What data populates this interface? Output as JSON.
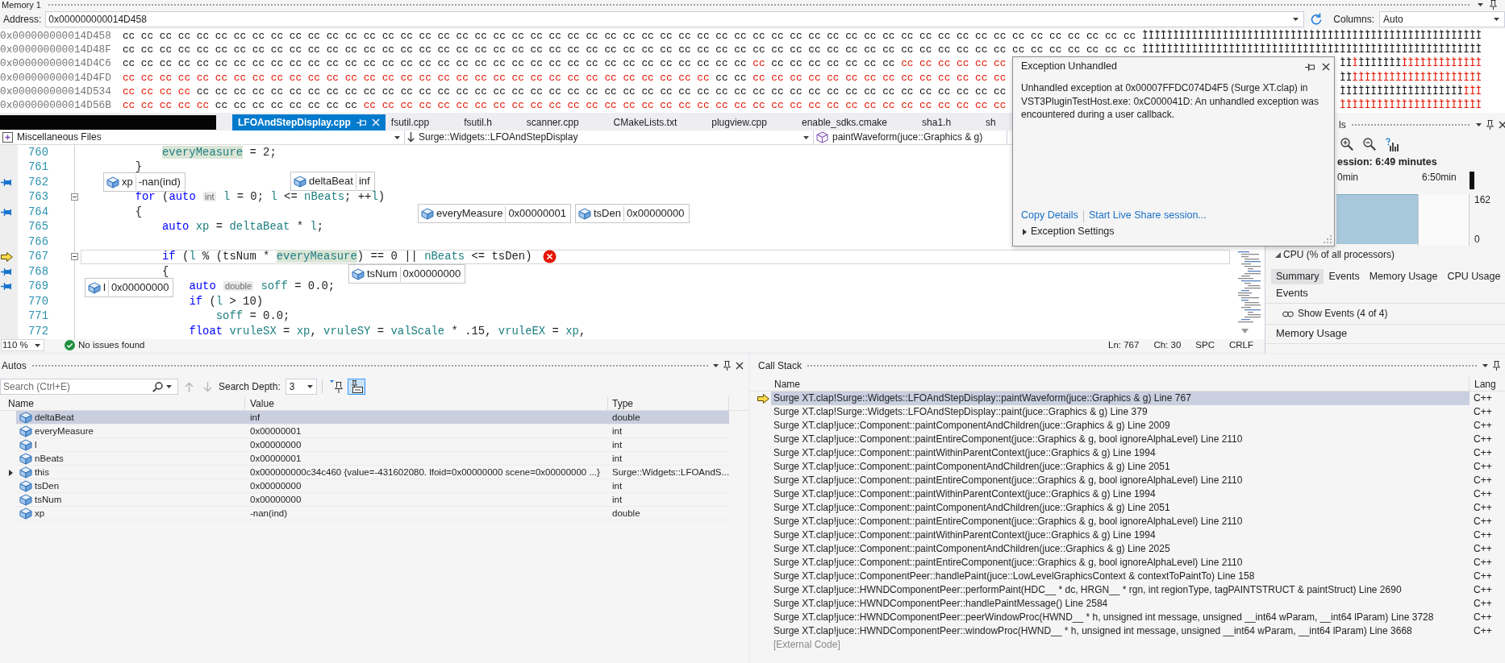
{
  "memory_window": {
    "title": "Memory 1",
    "address_label": "Address:",
    "address": "0x000000000014D458",
    "columns_label": "Columns:",
    "columns": "Auto",
    "rows": [
      {
        "address": "0x000000000014D458",
        "bytes": [
          {
            "text": "cc cc cc cc cc cc cc cc cc cc cc cc cc cc cc cc cc cc cc cc cc cc cc cc cc cc cc cc cc cc cc cc cc cc cc cc cc cc cc cc cc cc cc cc cc cc cc cc cc cc cc cc cc cc cc",
            "changed": false
          }
        ],
        "text": [
          {
            "text": "ÌÌÌÌÌÌÌÌÌÌÌÌÌÌÌÌÌÌÌÌÌÌÌÌÌÌÌÌÌÌÌÌÌÌÌÌÌÌÌÌÌÌÌÌÌÌÌÌÌÌÌÌÌÌÌ",
            "changed": false
          }
        ]
      },
      {
        "address": "0x000000000014D48F",
        "bytes": [
          {
            "text": "cc cc cc cc cc cc cc cc cc cc cc cc cc cc cc cc cc cc cc cc cc cc cc cc cc cc cc cc cc cc cc cc cc cc cc cc cc cc cc cc cc cc cc cc cc cc cc cc cc cc cc cc cc cc cc",
            "changed": false
          }
        ],
        "text": [
          {
            "text": "ÌÌÌÌÌÌÌÌÌÌÌÌÌÌÌÌÌÌÌÌÌÌÌÌÌÌÌÌÌÌÌÌÌÌÌÌÌÌÌÌÌÌÌÌÌÌÌÌÌÌÌÌÌÌÌ",
            "changed": false
          }
        ]
      },
      {
        "address": "0x000000000014D4C6",
        "bytes": [
          {
            "text": "cc cc cc cc cc cc cc cc cc cc cc cc cc cc cc cc cc cc cc cc cc cc cc cc cc cc cc cc cc cc cc cc cc cc",
            "changed": false
          },
          {
            "text": "cc",
            "changed": true
          },
          {
            "text": "cc cc cc cc cc cc cc",
            "changed": false
          },
          {
            "text": "cc cc cc cc cc cc",
            "changed": true
          }
        ],
        "text": [
          {
            "text": "ÌÌ",
            "changed": false
          },
          {
            "text": "Ì",
            "changed": true
          },
          {
            "text": "ÌÌÌÌÌÌÌ",
            "changed": false
          },
          {
            "text": "ÌÌÌÌÌÌÌÌÌÌÌÌÌ",
            "changed": true
          }
        ]
      },
      {
        "address": "0x000000000014D4FD",
        "bytes": [
          {
            "text": "cc cc cc cc cc cc cc cc cc cc cc cc cc cc cc cc cc cc cc cc cc cc cc cc cc cc cc cc cc cc cc cc",
            "changed": true
          },
          {
            "text": "cc cc",
            "changed": false
          },
          {
            "text": "cc cc cc cc cc cc cc cc cc cc cc cc cc cc",
            "changed": true
          }
        ],
        "text": [
          {
            "text": "ÌÌ",
            "changed": false
          },
          {
            "text": "ÌÌÌÌÌÌÌÌÌÌÌÌÌÌÌÌÌÌÌÌÌ",
            "changed": true
          }
        ]
      },
      {
        "address": "0x000000000014D534",
        "bytes": [
          {
            "text": "cc cc cc cc",
            "changed": true
          },
          {
            "text": "cc cc cc cc cc cc cc cc cc cc cc cc cc cc cc cc cc cc cc cc cc cc cc cc cc cc cc cc cc cc cc cc cc cc cc cc cc cc cc cc cc cc cc cc",
            "changed": false
          }
        ],
        "text": [
          {
            "text": "ÌÌÌÌÌÌÌÌÌÌÌÌÌÌÌÌÌÌÌÌ",
            "changed": false
          },
          {
            "text": "ÌÌÌ",
            "changed": true
          }
        ]
      },
      {
        "address": "0x000000000014D56B",
        "bytes": [
          {
            "text": "cc cc cc cc cc",
            "changed": true
          },
          {
            "text": "cc cc cc cc cc cc cc cc",
            "changed": false
          },
          {
            "text": "cc cc cc cc cc cc cc cc cc cc cc cc cc cc cc cc cc cc cc cc cc cc cc cc cc cc cc cc cc cc cc cc cc cc cc",
            "changed": true
          }
        ],
        "text": [
          {
            "text": "ÌÌÌÌÌÌÌÌÌÌÌÌÌÌÌÌÌÌÌÌÌÌÌ",
            "changed": true
          }
        ]
      }
    ]
  },
  "editor": {
    "tabs": [
      {
        "label": "LFOAndStepDisplay.cpp",
        "selected": true
      },
      {
        "label": "fsutil.cpp",
        "selected": false
      },
      {
        "label": "fsutil.h",
        "selected": false
      },
      {
        "label": "scanner.cpp",
        "selected": false
      },
      {
        "label": "CMakeLists.txt",
        "selected": false
      },
      {
        "label": "plugview.cpp",
        "selected": false
      },
      {
        "label": "enable_sdks.cmake",
        "selected": false
      },
      {
        "label": "sha1.h",
        "selected": false
      },
      {
        "label": "sh",
        "selected": false
      }
    ],
    "navigation": {
      "project": "Miscellaneous Files",
      "scope": "Surge::Widgets::LFOAndStepDisplay",
      "member": "paintWaveform(juce::Graphics & g)"
    },
    "lines": [
      {
        "number": "760",
        "tokens": [
          {
            "kind": "reference",
            "text": "            everyMeasure"
          },
          {
            "kind": "plain",
            "text": " = 2;"
          }
        ],
        "pinned": false,
        "foldable": false,
        "current": false,
        "exception": false
      },
      {
        "number": "761",
        "tokens": [
          {
            "kind": "plain",
            "text": "        }"
          }
        ],
        "pinned": false,
        "foldable": false,
        "current": false,
        "exception": false
      },
      {
        "number": "762",
        "pinned": true,
        "foldable": false,
        "current": false,
        "exception": false
      },
      {
        "number": "763",
        "tokens": [
          {
            "kind": "keyword",
            "text": "        for"
          },
          {
            "kind": "plain",
            "text": " ("
          },
          {
            "kind": "keyword",
            "text": "auto "
          },
          {
            "kind": "hint",
            "text": "int"
          },
          {
            "kind": "variable",
            "text": " l"
          },
          {
            "kind": "plain",
            "text": " = 0; "
          },
          {
            "kind": "variable",
            "text": "l"
          },
          {
            "kind": "plain",
            "text": " <= "
          },
          {
            "kind": "variable",
            "text": "nBeats"
          },
          {
            "kind": "plain",
            "text": "; ++"
          },
          {
            "kind": "variable",
            "text": "l"
          },
          {
            "kind": "plain",
            "text": ")"
          }
        ],
        "pinned": false,
        "foldable": true,
        "current": false,
        "exception": false
      },
      {
        "number": "764",
        "tokens": [
          {
            "kind": "plain",
            "text": "        {"
          }
        ],
        "pinned": true,
        "foldable": false,
        "current": false,
        "exception": false
      },
      {
        "number": "765",
        "tokens": [
          {
            "kind": "keyword",
            "text": "            auto "
          },
          {
            "kind": "variable",
            "text": "xp"
          },
          {
            "kind": "plain",
            "text": " = "
          },
          {
            "kind": "variable",
            "text": "deltaBeat"
          },
          {
            "kind": "plain",
            "text": " * "
          },
          {
            "kind": "variable",
            "text": "l"
          },
          {
            "kind": "plain",
            "text": ";"
          }
        ],
        "pinned": false,
        "foldable": false,
        "current": false,
        "exception": false
      },
      {
        "number": "766",
        "pinned": false,
        "foldable": false,
        "current": false,
        "exception": false
      },
      {
        "number": "767",
        "tokens": [
          {
            "kind": "keyword",
            "text": "            if"
          },
          {
            "kind": "plain",
            "text": " ("
          },
          {
            "kind": "variable",
            "text": "l"
          },
          {
            "kind": "plain",
            "text": " % (tsNum * "
          },
          {
            "kind": "reference",
            "text": "everyMeasure"
          },
          {
            "kind": "plain",
            "text": ") == 0 || "
          },
          {
            "kind": "variable",
            "text": "nBeats"
          },
          {
            "kind": "plain",
            "text": " <= tsDen)"
          }
        ],
        "pinned": false,
        "foldable": true,
        "current": true,
        "exception": true
      },
      {
        "number": "768",
        "tokens": [
          {
            "kind": "plain",
            "text": "            {"
          }
        ],
        "pinned": true,
        "foldable": false,
        "current": false,
        "exception": false
      },
      {
        "number": "769",
        "tokens": [
          {
            "kind": "keyword",
            "text": "                auto "
          },
          {
            "kind": "hint",
            "text": "double"
          },
          {
            "kind": "variable",
            "text": " soff"
          },
          {
            "kind": "plain",
            "text": " = 0.0;"
          }
        ],
        "pinned": true,
        "foldable": false,
        "current": false,
        "exception": false
      },
      {
        "number": "770",
        "tokens": [
          {
            "kind": "keyword",
            "text": "                if"
          },
          {
            "kind": "plain",
            "text": " ("
          },
          {
            "kind": "variable",
            "text": "l"
          },
          {
            "kind": "plain",
            "text": " > 10)"
          }
        ],
        "pinned": false,
        "foldable": false,
        "current": false,
        "exception": false
      },
      {
        "number": "771",
        "tokens": [
          {
            "kind": "variable",
            "text": "                    soff"
          },
          {
            "kind": "plain",
            "text": " = 0.0;"
          }
        ],
        "pinned": false,
        "foldable": false,
        "current": false,
        "exception": false
      },
      {
        "number": "772",
        "tokens": [
          {
            "kind": "keyword",
            "text": "                float "
          },
          {
            "kind": "variable",
            "text": "vruleSX"
          },
          {
            "kind": "plain",
            "text": " = "
          },
          {
            "kind": "variable",
            "text": "xp"
          },
          {
            "kind": "plain",
            "text": ", "
          },
          {
            "kind": "variable",
            "text": "vruleSY"
          },
          {
            "kind": "plain",
            "text": " = "
          },
          {
            "kind": "variable",
            "text": "valScale"
          },
          {
            "kind": "plain",
            "text": " * .15, "
          },
          {
            "kind": "variable",
            "text": "vruleEX"
          },
          {
            "kind": "plain",
            "text": " = "
          },
          {
            "kind": "variable",
            "text": "xp"
          },
          {
            "kind": "plain",
            "text": ","
          }
        ],
        "pinned": false,
        "foldable": false,
        "current": false,
        "exception": false
      }
    ],
    "datatips": [
      {
        "name": "xp",
        "value": "-nan(ind)"
      },
      {
        "name": "deltaBeat",
        "value": "inf"
      },
      {
        "name": "everyMeasure",
        "value": "0x00000001"
      },
      {
        "name": "tsDen",
        "value": "0x00000000"
      },
      {
        "name": "tsNum",
        "value": "0x00000000"
      },
      {
        "name": "l",
        "value": "0x00000000"
      }
    ],
    "status_bar": {
      "zoom": "110 %",
      "issues": "No issues found",
      "line": "Ln: 767",
      "column": "Ch: 30",
      "whitespace": "SPC",
      "line_endings": "CRLF"
    }
  },
  "exception_popup": {
    "title": "Exception Unhandled",
    "message": "Unhandled exception at 0x00007FFDC074D4F5 (Surge XT.clap) in VST3PluginTestHost.exe: 0xC000041D: An unhandled exception was encountered during a user callback.",
    "links": [
      "Copy Details",
      "Start Live Share session..."
    ],
    "settings": "Exception Settings"
  },
  "diagnostic_tools": {
    "title": "ls",
    "session": "ession: 6:49 minutes",
    "time_labels": [
      "0min",
      "6:50min"
    ],
    "value_labels": [
      "162",
      "0"
    ],
    "section": "CPU (% of all processors)",
    "tabs": [
      {
        "label": "Summary",
        "selected": true
      },
      {
        "label": "Events",
        "selected": false
      },
      {
        "label": "Memory Usage",
        "selected": false
      },
      {
        "label": "CPU Usage",
        "selected": false
      }
    ],
    "events_heading": "Events",
    "events_link": "Show Events (4 of 4)",
    "memory_heading": "Memory Usage"
  },
  "autos": {
    "title": "Autos",
    "search": {
      "placeholder": "Search (Ctrl+E)"
    },
    "depth_label": "Search Depth:",
    "depth": "3",
    "toggles": [
      {
        "kind": "pin",
        "selected": false
      },
      {
        "kind": "format",
        "selected": true
      }
    ],
    "columns": [
      "Name",
      "Value",
      "Type"
    ],
    "rows": [
      {
        "name": "deltaBeat",
        "value": "inf",
        "type": "double",
        "selected": true,
        "expandable": false
      },
      {
        "name": "everyMeasure",
        "value": "0x00000001",
        "type": "int",
        "selected": false,
        "expandable": false
      },
      {
        "name": "l",
        "value": "0x00000000",
        "type": "int",
        "selected": false,
        "expandable": false
      },
      {
        "name": "nBeats",
        "value": "0x00000001",
        "type": "int",
        "selected": false,
        "expandable": false
      },
      {
        "name": "this",
        "value": "0x000000000c34c460 {value=-431602080. lfoid=0x00000000 scene=0x00000000 ...}",
        "type": "Surge::Widgets::LFOAndS...",
        "selected": false,
        "expandable": true
      },
      {
        "name": "tsDen",
        "value": "0x00000000",
        "type": "int",
        "selected": false,
        "expandable": false
      },
      {
        "name": "tsNum",
        "value": "0x00000000",
        "type": "int",
        "selected": false,
        "expandable": false
      },
      {
        "name": "xp",
        "value": "-nan(ind)",
        "type": "double",
        "selected": false,
        "expandable": false
      }
    ]
  },
  "call_stack": {
    "title": "Call Stack",
    "columns": [
      "Name",
      "Lang"
    ],
    "frames": [
      {
        "kind": "frame",
        "name": "Surge XT.clap!Surge::Widgets::LFOAndStepDisplay::paintWaveform(juce::Graphics & g) Line 767",
        "language": "C++",
        "selected": true,
        "current": true
      },
      {
        "kind": "frame",
        "name": "Surge XT.clap!Surge::Widgets::LFOAndStepDisplay::paint(juce::Graphics & g) Line 379",
        "language": "C++",
        "selected": false,
        "current": false
      },
      {
        "kind": "frame",
        "name": "Surge XT.clap!juce::Component::paintComponentAndChildren(juce::Graphics & g) Line 2009",
        "language": "C++",
        "selected": false,
        "current": false
      },
      {
        "kind": "frame",
        "name": "Surge XT.clap!juce::Component::paintEntireComponent(juce::Graphics & g, bool ignoreAlphaLevel) Line 2110",
        "language": "C++",
        "selected": false,
        "current": false
      },
      {
        "kind": "frame",
        "name": "Surge XT.clap!juce::Component::paintWithinParentContext(juce::Graphics & g) Line 1994",
        "language": "C++",
        "selected": false,
        "current": false
      },
      {
        "kind": "frame",
        "name": "Surge XT.clap!juce::Component::paintComponentAndChildren(juce::Graphics & g) Line 2051",
        "language": "C++",
        "selected": false,
        "current": false
      },
      {
        "kind": "frame",
        "name": "Surge XT.clap!juce::Component::paintEntireComponent(juce::Graphics & g, bool ignoreAlphaLevel) Line 2110",
        "language": "C++",
        "selected": false,
        "current": false
      },
      {
        "kind": "frame",
        "name": "Surge XT.clap!juce::Component::paintWithinParentContext(juce::Graphics & g) Line 1994",
        "language": "C++",
        "selected": false,
        "current": false
      },
      {
        "kind": "frame",
        "name": "Surge XT.clap!juce::Component::paintComponentAndChildren(juce::Graphics & g) Line 2051",
        "language": "C++",
        "selected": false,
        "current": false
      },
      {
        "kind": "frame",
        "name": "Surge XT.clap!juce::Component::paintEntireComponent(juce::Graphics & g, bool ignoreAlphaLevel) Line 2110",
        "language": "C++",
        "selected": false,
        "current": false
      },
      {
        "kind": "frame",
        "name": "Surge XT.clap!juce::Component::paintWithinParentContext(juce::Graphics & g) Line 1994",
        "language": "C++",
        "selected": false,
        "current": false
      },
      {
        "kind": "frame",
        "name": "Surge XT.clap!juce::Component::paintComponentAndChildren(juce::Graphics & g) Line 2025",
        "language": "C++",
        "selected": false,
        "current": false
      },
      {
        "kind": "frame",
        "name": "Surge XT.clap!juce::Component::paintEntireComponent(juce::Graphics & g, bool ignoreAlphaLevel) Line 2110",
        "language": "C++",
        "selected": false,
        "current": false
      },
      {
        "kind": "frame",
        "name": "Surge XT.clap!juce::ComponentPeer::handlePaint(juce::LowLevelGraphicsContext & contextToPaintTo) Line 158",
        "language": "C++",
        "selected": false,
        "current": false
      },
      {
        "kind": "frame",
        "name": "Surge XT.clap!juce::HWNDComponentPeer::performPaint(HDC__ * dc, HRGN__ * rgn, int regionType, tagPAINTSTRUCT & paintStruct) Line 2690",
        "language": "C++",
        "selected": false,
        "current": false
      },
      {
        "kind": "frame",
        "name": "Surge XT.clap!juce::HWNDComponentPeer::handlePaintMessage() Line 2584",
        "language": "C++",
        "selected": false,
        "current": false
      },
      {
        "kind": "frame",
        "name": "Surge XT.clap!juce::HWNDComponentPeer::peerWindowProc(HWND__ * h, unsigned int message, unsigned __int64 wParam, __int64 lParam) Line 3728",
        "language": "C++",
        "selected": false,
        "current": false
      },
      {
        "kind": "frame",
        "name": "Surge XT.clap!juce::HWNDComponentPeer::windowProc(HWND__ * h, unsigned int message, unsigned __int64 wParam, __int64 lParam) Line 3668",
        "language": "C++",
        "selected": false,
        "current": false
      },
      {
        "kind": "external",
        "name": "[External Code]",
        "selected": false,
        "current": false
      }
    ]
  }
}
